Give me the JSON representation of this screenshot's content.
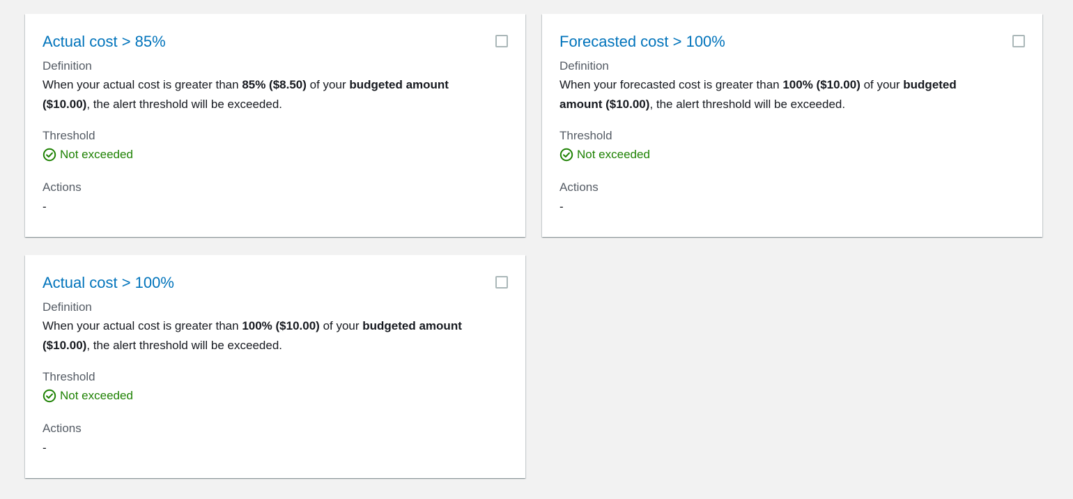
{
  "colors": {
    "link": "#0073bb",
    "success": "#1d8102",
    "background": "#f2f2f2"
  },
  "alerts": [
    {
      "title": "Actual cost > 85%",
      "definition_label": "Definition",
      "definition": {
        "prefix": "When your actual cost is greater than ",
        "threshold": "85% ($8.50)",
        "middle": " of your ",
        "budget_part1": "budgeted amount",
        "budget_part2": "($10.00)",
        "suffix": ", the alert threshold will be exceeded."
      },
      "threshold_label": "Threshold",
      "status_icon": "check-circle-icon",
      "status": "Not exceeded",
      "actions_label": "Actions",
      "actions_value": "-"
    },
    {
      "title": "Forecasted cost > 100%",
      "definition_label": "Definition",
      "definition": {
        "prefix": "When your forecasted cost is greater than ",
        "threshold": "100% ($10.00)",
        "middle": " of your ",
        "budget_part1": "budgeted",
        "budget_part2": "amount ($10.00)",
        "suffix": ", the alert threshold will be exceeded."
      },
      "threshold_label": "Threshold",
      "status_icon": "check-circle-icon",
      "status": "Not exceeded",
      "actions_label": "Actions",
      "actions_value": "-"
    },
    {
      "title": "Actual cost > 100%",
      "definition_label": "Definition",
      "definition": {
        "prefix": "When your actual cost is greater than ",
        "threshold": "100% ($10.00)",
        "middle": " of your ",
        "budget_part1": "budgeted amount",
        "budget_part2": "($10.00)",
        "suffix": ", the alert threshold will be exceeded."
      },
      "threshold_label": "Threshold",
      "status_icon": "check-circle-icon",
      "status": "Not exceeded",
      "actions_label": "Actions",
      "actions_value": "-"
    }
  ]
}
